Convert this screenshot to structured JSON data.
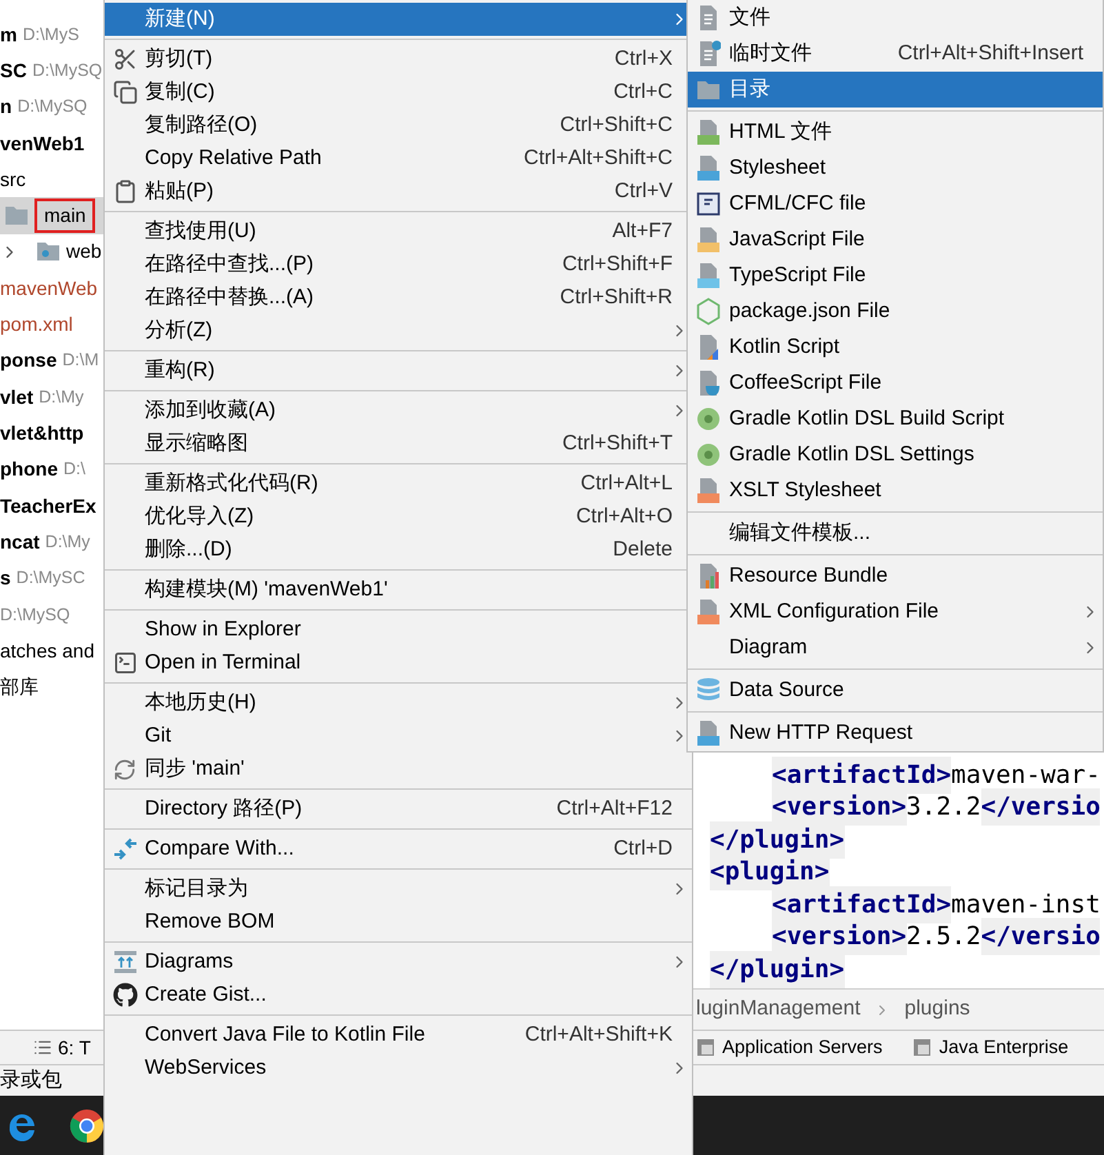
{
  "project_tree": {
    "items": [
      {
        "kind": "project",
        "name": "m",
        "path": "D:\\MyS",
        "selected": false
      },
      {
        "kind": "project",
        "name": "SC",
        "path": "D:\\MySQ",
        "selected": false
      },
      {
        "kind": "project",
        "name": "n",
        "path": "D:\\MySQ",
        "selected": false
      },
      {
        "kind": "project",
        "name": "venWeb1",
        "selected": false
      },
      {
        "kind": "plain",
        "name": "src",
        "selected": false
      },
      {
        "kind": "folder",
        "name": "main",
        "selected": true
      },
      {
        "kind": "expandable",
        "name": "web",
        "expanded": false,
        "selected": false
      },
      {
        "kind": "file",
        "name": "mavenWeb",
        "selected": false
      },
      {
        "kind": "file",
        "name": "pom.xml",
        "selected": false
      },
      {
        "kind": "project",
        "name": "ponse",
        "path": "D:\\M",
        "selected": false
      },
      {
        "kind": "project",
        "name": "vlet",
        "path": "D:\\My",
        "selected": false
      },
      {
        "kind": "project",
        "name": "vlet&http",
        "selected": false
      },
      {
        "kind": "project",
        "name": "phone",
        "path": "D:\\",
        "selected": false
      },
      {
        "kind": "project",
        "name": "TeacherEx",
        "selected": false
      },
      {
        "kind": "project",
        "name": "ncat",
        "path": "D:\\My",
        "selected": false
      },
      {
        "kind": "project",
        "name": "s",
        "path": "D:\\MySC",
        "selected": false
      },
      {
        "kind": "project",
        "path": "D:\\MySQ",
        "selected": false
      },
      {
        "kind": "plain",
        "name": "atches and",
        "selected": false
      },
      {
        "kind": "plain",
        "name": "部库",
        "selected": false
      }
    ]
  },
  "editor": {
    "code_lines": [
      {
        "nested": true,
        "segments": [
          {
            "kind": "tag",
            "text": "<artifactId>"
          },
          {
            "kind": "value",
            "text": "maven-war-"
          }
        ]
      },
      {
        "nested": true,
        "segments": [
          {
            "kind": "tag",
            "text": "<version>"
          },
          {
            "kind": "value",
            "text": "3.2.2"
          },
          {
            "kind": "tag",
            "text": "</versio"
          }
        ]
      },
      {
        "nested": false,
        "segments": [
          {
            "kind": "tag",
            "text": "</plugin>"
          }
        ]
      },
      {
        "nested": false,
        "segments": [
          {
            "kind": "tag",
            "text": "<plugin>"
          }
        ]
      },
      {
        "nested": true,
        "segments": [
          {
            "kind": "tag",
            "text": "<artifactId>"
          },
          {
            "kind": "value",
            "text": "maven-inst"
          }
        ]
      },
      {
        "nested": true,
        "segments": [
          {
            "kind": "tag",
            "text": "<version>"
          },
          {
            "kind": "value",
            "text": "2.5.2"
          },
          {
            "kind": "tag",
            "text": "</versio"
          }
        ]
      },
      {
        "nested": false,
        "segments": [
          {
            "kind": "tag",
            "text": "</plugin>"
          }
        ]
      }
    ],
    "breadcrumb": [
      "luginManagement",
      "plugins"
    ]
  },
  "tool_window_bar": {
    "left": [
      {
        "label": "6: T"
      }
    ],
    "right": [
      {
        "label": "Application Servers"
      },
      {
        "label": "Java Enterprise"
      }
    ]
  },
  "status_bar": {
    "text": "录或包"
  },
  "context_menu": {
    "sections": [
      [
        {
          "label": "新建(N)",
          "selected": true,
          "submenu": true
        }
      ],
      [
        {
          "label": "剪切(T)",
          "shortcut": "Ctrl+X",
          "selected": false,
          "submenu": false
        },
        {
          "label": "复制(C)",
          "shortcut": "Ctrl+C",
          "selected": false,
          "submenu": false
        },
        {
          "label": "复制路径(O)",
          "shortcut": "Ctrl+Shift+C",
          "selected": false,
          "submenu": false
        },
        {
          "label": "Copy Relative Path",
          "shortcut": "Ctrl+Alt+Shift+C",
          "selected": false,
          "submenu": false
        },
        {
          "label": "粘贴(P)",
          "shortcut": "Ctrl+V",
          "selected": false,
          "submenu": false
        }
      ],
      [
        {
          "label": "查找使用(U)",
          "shortcut": "Alt+F7",
          "selected": false,
          "submenu": false
        },
        {
          "label": "在路径中查找...(P)",
          "shortcut": "Ctrl+Shift+F",
          "selected": false,
          "submenu": false
        },
        {
          "label": "在路径中替换...(A)",
          "shortcut": "Ctrl+Shift+R",
          "selected": false,
          "submenu": false
        },
        {
          "label": "分析(Z)",
          "selected": false,
          "submenu": true
        }
      ],
      [
        {
          "label": "重构(R)",
          "selected": false,
          "submenu": true
        }
      ],
      [
        {
          "label": "添加到收藏(A)",
          "selected": false,
          "submenu": true
        },
        {
          "label": "显示缩略图",
          "shortcut": "Ctrl+Shift+T",
          "selected": false,
          "submenu": false
        }
      ],
      [
        {
          "label": "重新格式化代码(R)",
          "shortcut": "Ctrl+Alt+L",
          "selected": false,
          "submenu": false
        },
        {
          "label": "优化导入(Z)",
          "shortcut": "Ctrl+Alt+O",
          "selected": false,
          "submenu": false
        },
        {
          "label": "删除...(D)",
          "shortcut": "Delete",
          "selected": false,
          "submenu": false
        }
      ],
      [
        {
          "label": "构建模块(M) 'mavenWeb1'",
          "selected": false,
          "submenu": false
        }
      ],
      [
        {
          "label": "Show in Explorer",
          "selected": false,
          "submenu": false
        },
        {
          "label": "Open in Terminal",
          "selected": false,
          "submenu": false
        }
      ],
      [
        {
          "label": "本地历史(H)",
          "selected": false,
          "submenu": true
        },
        {
          "label": "Git",
          "selected": false,
          "submenu": true
        },
        {
          "label": "同步 'main'",
          "selected": false,
          "submenu": false
        }
      ],
      [
        {
          "label": "Directory 路径(P)",
          "shortcut": "Ctrl+Alt+F12",
          "selected": false,
          "submenu": false
        }
      ],
      [
        {
          "label": "Compare With...",
          "shortcut": "Ctrl+D",
          "selected": false,
          "submenu": false
        }
      ],
      [
        {
          "label": "标记目录为",
          "selected": false,
          "submenu": true
        },
        {
          "label": "Remove BOM",
          "selected": false,
          "submenu": false
        }
      ],
      [
        {
          "label": "Diagrams",
          "selected": false,
          "submenu": true
        },
        {
          "label": "Create Gist...",
          "selected": false,
          "submenu": false
        }
      ],
      [
        {
          "label": "Convert Java File to Kotlin File",
          "shortcut": "Ctrl+Alt+Shift+K",
          "selected": false,
          "submenu": false
        },
        {
          "label": "WebServices",
          "selected": false,
          "submenu": true
        }
      ]
    ]
  },
  "new_submenu": {
    "sections": [
      [
        {
          "label": "文件",
          "selected": false,
          "submenu": false
        },
        {
          "label": "临时文件",
          "shortcut": "Ctrl+Alt+Shift+Insert",
          "selected": false,
          "submenu": false
        },
        {
          "label": "目录",
          "selected": true,
          "submenu": false
        }
      ],
      [
        {
          "label": "HTML 文件",
          "selected": false,
          "submenu": false
        },
        {
          "label": "Stylesheet",
          "selected": false,
          "submenu": false
        },
        {
          "label": "CFML/CFC file",
          "selected": false,
          "submenu": false
        },
        {
          "label": "JavaScript File",
          "selected": false,
          "submenu": false
        },
        {
          "label": "TypeScript File",
          "selected": false,
          "submenu": false
        },
        {
          "label": "package.json File",
          "selected": false,
          "submenu": false
        },
        {
          "label": "Kotlin Script",
          "selected": false,
          "submenu": false
        },
        {
          "label": "CoffeeScript File",
          "selected": false,
          "submenu": false
        },
        {
          "label": "Gradle Kotlin DSL Build Script",
          "selected": false,
          "submenu": false
        },
        {
          "label": "Gradle Kotlin DSL Settings",
          "selected": false,
          "submenu": false
        },
        {
          "label": "XSLT Stylesheet",
          "selected": false,
          "submenu": false
        }
      ],
      [
        {
          "label": "编辑文件模板...",
          "selected": false,
          "submenu": false
        }
      ],
      [
        {
          "label": "Resource Bundle",
          "selected": false,
          "submenu": false
        },
        {
          "label": "XML Configuration File",
          "selected": false,
          "submenu": true
        },
        {
          "label": "Diagram",
          "selected": false,
          "submenu": true
        }
      ],
      [
        {
          "label": "Data Source",
          "selected": false,
          "submenu": false
        }
      ],
      [
        {
          "label": "New HTTP Request",
          "selected": false,
          "submenu": false
        }
      ]
    ]
  }
}
